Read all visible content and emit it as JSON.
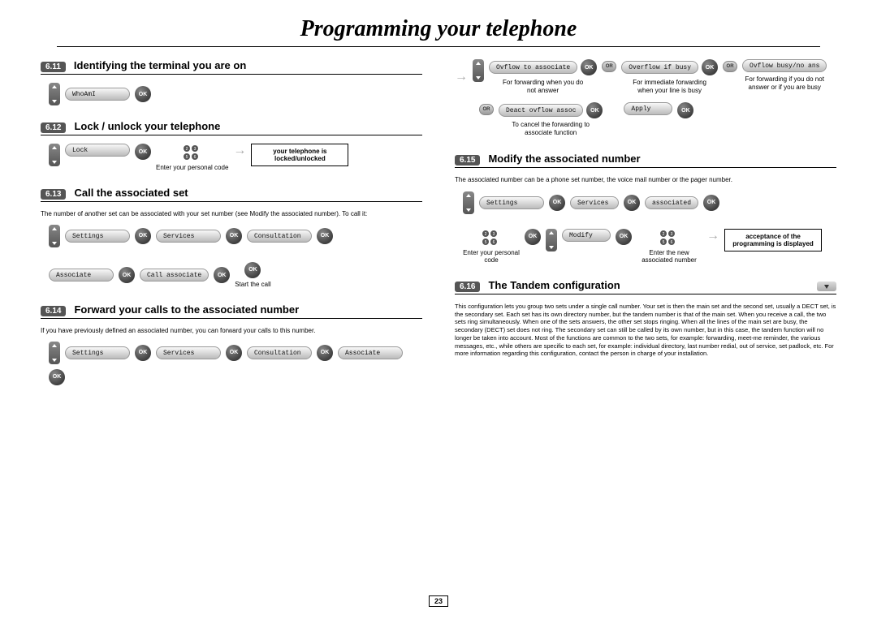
{
  "title": "Programming your telephone",
  "page_number": "23",
  "ok_label": "OK",
  "or_label": "OR",
  "left": {
    "s611": {
      "num": "6.11",
      "title": "Identifying the terminal you are on",
      "pill": "WhoAmI"
    },
    "s612": {
      "num": "6.12",
      "title": "Lock / unlock your telephone",
      "pill": "Lock",
      "caption": "Enter your personal code",
      "result": "your telephone is locked/unlocked"
    },
    "s613": {
      "num": "6.13",
      "title": "Call the associated set",
      "note": "The number of another set can be associated with your set number (see Modify the associated number). To call it:",
      "pills": {
        "settings": "Settings",
        "services": "Services",
        "consultation": "Consultation",
        "associate": "Associate",
        "call_assoc": "Call associate"
      },
      "caption": "Start the call"
    },
    "s614": {
      "num": "6.14",
      "title": "Forward your calls to the associated number",
      "note": "If you have previously defined an associated number, you can forward your calls to this number.",
      "pills": {
        "settings": "Settings",
        "services": "Services",
        "consultation": "Consultation",
        "associate": "Associate"
      }
    }
  },
  "right": {
    "flow": {
      "opt1": {
        "pill": "Ovflow to associate",
        "caption": "For forwarding when you do not answer"
      },
      "opt2": {
        "pill": "Overflow if busy",
        "caption": "For immediate forwarding when your line is busy"
      },
      "opt3": {
        "pill": "Ovflow busy/no ans",
        "caption": "For forwarding if you do not answer or if you are busy"
      },
      "deact": {
        "pill": "Deact ovflow assoc",
        "caption": "To cancel the forwarding to associate function"
      },
      "apply": {
        "pill": "Apply"
      }
    },
    "s615": {
      "num": "6.15",
      "title": "Modify the associated number",
      "note": "The associated number can be a phone set number, the voice mail number or the pager number.",
      "pills": {
        "settings": "Settings",
        "services": "Services",
        "associated": "associated",
        "modify": "Modify"
      },
      "cap1": "Enter your personal code",
      "cap2": "Enter the new associated number",
      "result": "acceptance of the programming is displayed"
    },
    "s616": {
      "num": "6.16",
      "title": "The Tandem configuration",
      "text": "This configuration lets you group two sets under a single call number. Your set is then the main set and the second set, usually a DECT set, is the secondary set. Each set has its own directory number, but the tandem number is that of the main set. When you receive a call, the two sets ring simultaneously. When one of the sets answers, the other set stops ringing. When all the lines of the main set are busy, the secondary (DECT) set does not ring. The secondary set can still be called by its own number, but in this case, the tandem function will no longer be taken into account. Most of the functions are common to the two sets, for example: forwarding, meet-me reminder, the various messages, etc., while others are specific to each set, for example: individual directory, last number redial, out of service, set padlock, etc. For more information regarding this configuration, contact the person in charge of your installation."
    }
  }
}
